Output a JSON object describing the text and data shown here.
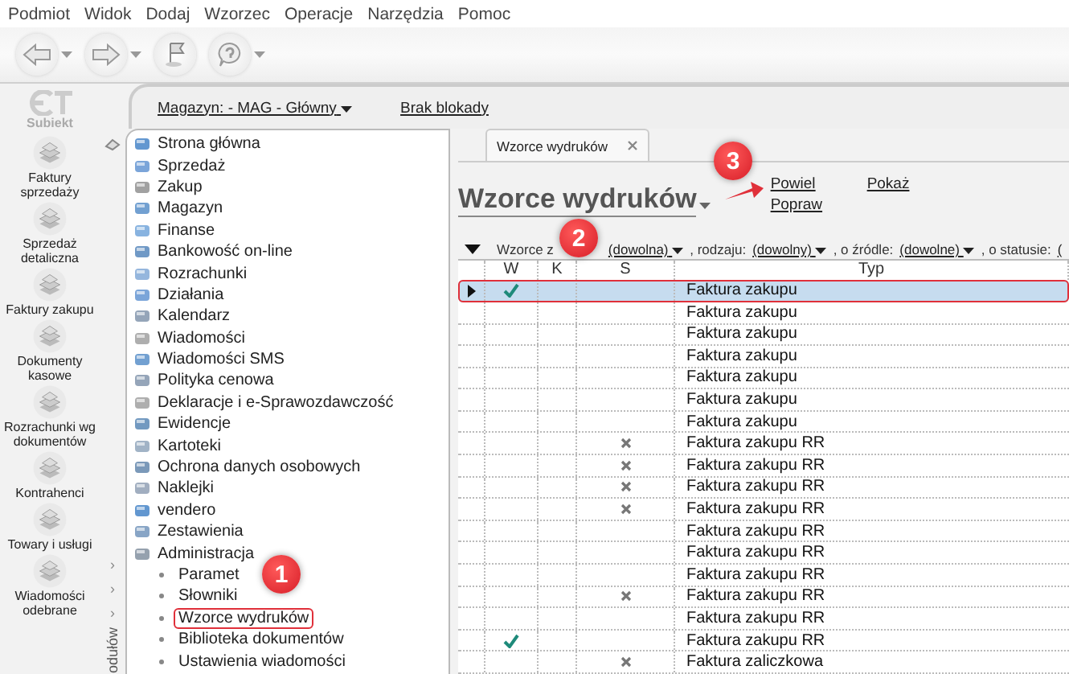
{
  "menu": [
    "Podmiot",
    "Widok",
    "Dodaj",
    "Wzorzec",
    "Operacje",
    "Narzędzia",
    "Pomoc"
  ],
  "toolbar": [
    {
      "dropdown": true
    },
    {
      "dropdown": true
    },
    {
      "dropdown": false
    },
    {
      "dropdown": true
    }
  ],
  "logo": "Subiekt",
  "modules": [
    "Faktury sprzedaży",
    "Sprzedaż detaliczna",
    "Faktury zakupu",
    "Dokumenty kasowe",
    "Rozrachunki wg dokumentów",
    "Kontrahenci",
    "Towary i usługi",
    "Wiadomości odebrane"
  ],
  "store_bar": {
    "warehouse": "Magazyn: - MAG - Główny",
    "lock": "Brak blokady"
  },
  "side_strip": {
    "chevrons": [
      "›",
      "›",
      "›"
    ],
    "label": "odułów"
  },
  "nav": [
    {
      "label": "Strona główna"
    },
    {
      "label": "Sprzedaż"
    },
    {
      "label": "Zakup"
    },
    {
      "label": "Magazyn"
    },
    {
      "label": "Finanse"
    },
    {
      "label": "Bankowość on-line"
    },
    {
      "label": "Rozrachunki"
    },
    {
      "label": "Działania"
    },
    {
      "label": "Kalendarz"
    },
    {
      "label": "Wiadomości"
    },
    {
      "label": "Wiadomości SMS"
    },
    {
      "label": "Polityka cenowa"
    },
    {
      "label": "Deklaracje i e-Sprawozdawczość"
    },
    {
      "label": "Ewidencje"
    },
    {
      "label": "Kartoteki"
    },
    {
      "label": "Ochrona danych osobowych"
    },
    {
      "label": "Naklejki"
    },
    {
      "label": "vendero"
    },
    {
      "label": "Zestawienia"
    },
    {
      "label": "Administracja",
      "expanded": true,
      "children": [
        {
          "label": "Paramet",
          "selected": false
        },
        {
          "label": "Słowniki",
          "selected": false
        },
        {
          "label": "Wzorce wydruków",
          "selected": true
        },
        {
          "label": "Biblioteka dokumentów",
          "selected": false
        },
        {
          "label": "Ustawienia wiadomości",
          "selected": false
        }
      ]
    }
  ],
  "tab": {
    "label": "Wzorce wydruków"
  },
  "header": {
    "title": "Wzorce wydruków",
    "actions": [
      "Powiel",
      "Popraw",
      "Pokaż"
    ]
  },
  "filter": [
    {
      "label": "Wzorce z",
      "value": "(dowolna)",
      "dropdown": true
    },
    {
      "label": ", rodzaju:",
      "value": "(dowolny)",
      "dropdown": true
    },
    {
      "label": ", o źródle:",
      "value": "(dowolne)",
      "dropdown": true
    },
    {
      "label": ", o statusie:",
      "value": "(",
      "dropdown": false
    }
  ],
  "table": {
    "columns": [
      "W",
      "K",
      "S",
      "Typ"
    ],
    "rows": [
      {
        "w": true,
        "s": false,
        "typ": "Faktura zakupu",
        "selected": true
      },
      {
        "w": false,
        "s": false,
        "typ": "Faktura zakupu",
        "selected": false
      },
      {
        "w": false,
        "s": false,
        "typ": "Faktura zakupu",
        "selected": false
      },
      {
        "w": false,
        "s": false,
        "typ": "Faktura zakupu",
        "selected": false
      },
      {
        "w": false,
        "s": false,
        "typ": "Faktura zakupu",
        "selected": false
      },
      {
        "w": false,
        "s": false,
        "typ": "Faktura zakupu",
        "selected": false
      },
      {
        "w": false,
        "s": false,
        "typ": "Faktura zakupu",
        "selected": false
      },
      {
        "w": false,
        "s": true,
        "typ": "Faktura zakupu RR",
        "selected": false
      },
      {
        "w": false,
        "s": true,
        "typ": "Faktura zakupu RR",
        "selected": false
      },
      {
        "w": false,
        "s": true,
        "typ": "Faktura zakupu RR",
        "selected": false
      },
      {
        "w": false,
        "s": true,
        "typ": "Faktura zakupu RR",
        "selected": false
      },
      {
        "w": false,
        "s": false,
        "typ": "Faktura zakupu RR",
        "selected": false
      },
      {
        "w": false,
        "s": false,
        "typ": "Faktura zakupu RR",
        "selected": false
      },
      {
        "w": false,
        "s": false,
        "typ": "Faktura zakupu RR",
        "selected": false
      },
      {
        "w": false,
        "s": true,
        "typ": "Faktura zakupu RR",
        "selected": false
      },
      {
        "w": false,
        "s": false,
        "typ": "Faktura zakupu RR",
        "selected": false
      },
      {
        "w": true,
        "s": false,
        "typ": "Faktura zakupu RR",
        "selected": false
      },
      {
        "w": false,
        "s": true,
        "typ": "Faktura zaliczkowa",
        "selected": false
      }
    ]
  },
  "annotations": [
    {
      "number": "1"
    },
    {
      "number": "2"
    },
    {
      "number": "3"
    }
  ]
}
